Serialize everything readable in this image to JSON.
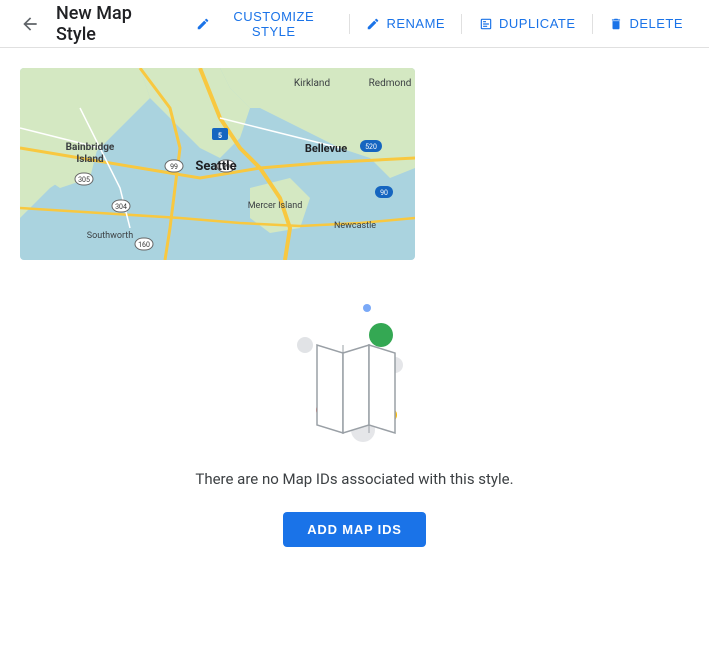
{
  "header": {
    "back_label": "←",
    "title": "New Map Style",
    "actions": [
      {
        "id": "customize",
        "label": "CUSTOMIZE STYLE",
        "icon": "pencil"
      },
      {
        "id": "rename",
        "label": "RENAME",
        "icon": "pencil"
      },
      {
        "id": "duplicate",
        "label": "DUPLICATE",
        "icon": "duplicate"
      },
      {
        "id": "delete",
        "label": "DELETE",
        "icon": "trash"
      }
    ]
  },
  "empty_state": {
    "message": "There are no Map IDs associated with this style.",
    "button_label": "ADD MAP IDS"
  },
  "colors": {
    "primary": "#1a73e8",
    "text_primary": "#202124",
    "text_secondary": "#3c4043",
    "icon_blue": "#4285f4",
    "dot_green": "#34a853",
    "dot_red": "#ea4335",
    "dot_yellow": "#fbbc04",
    "dot_blue": "#4285f4",
    "dot_light_gray": "#dadce0"
  }
}
